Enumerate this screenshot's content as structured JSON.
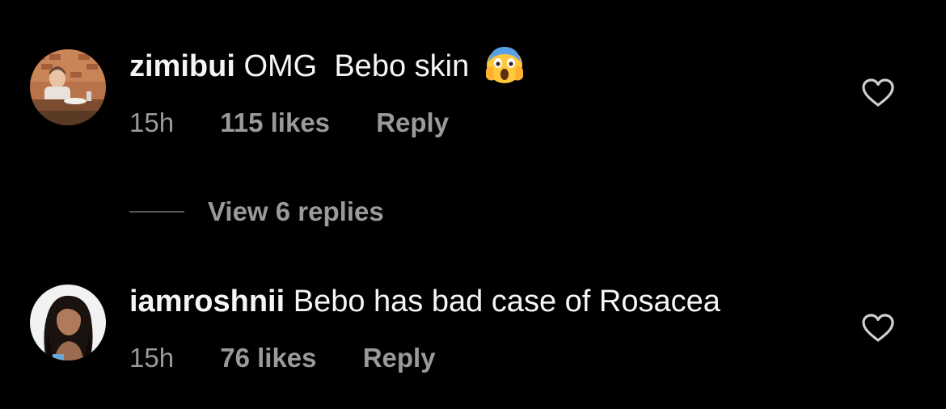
{
  "comments": [
    {
      "username": "zimibui",
      "text": "OMG  Bebo skin",
      "emoji": "face-screaming-in-fear",
      "time": "15h",
      "likes": "115 likes",
      "reply_label": "Reply",
      "liked": false
    },
    {
      "username": "iamroshnii",
      "text": "Bebo has bad case of Rosacea",
      "time": "15h",
      "likes": "76 likes",
      "reply_label": "Reply",
      "liked": false
    }
  ],
  "view_replies_label": "View 6 replies",
  "colors": {
    "background": "#000000",
    "primary_text": "#f5f5f5",
    "secondary_text": "#9a9a9a",
    "divider": "#555555"
  }
}
